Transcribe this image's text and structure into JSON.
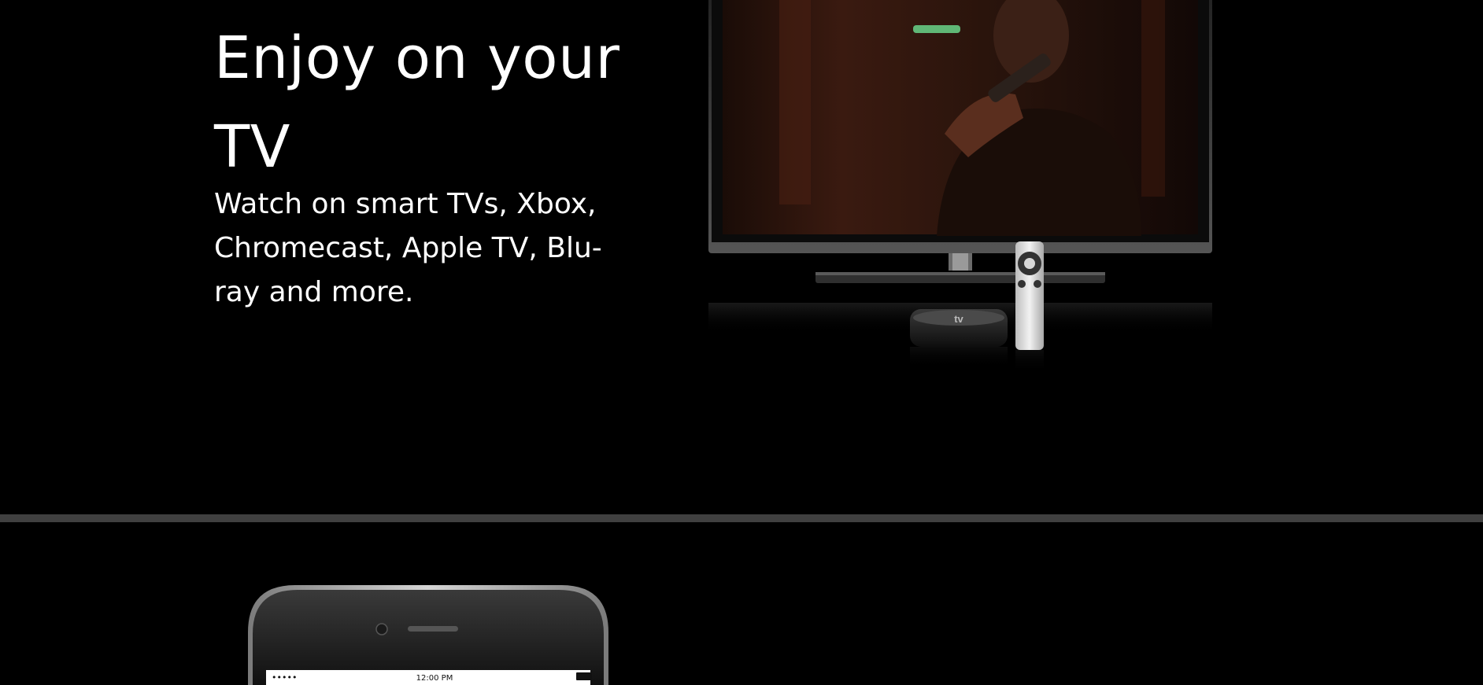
{
  "tv_section": {
    "title": "Enjoy on your TV",
    "subtitle": "Watch on smart TVs, Xbox, Chromecast, Apple TV, Blu-ray and more.",
    "apple_tv_label": "tv"
  },
  "phone_section": {
    "status_time": "12:00 PM",
    "signal": "•••••"
  },
  "colors": {
    "background": "#000000",
    "divider": "#404040",
    "text": "#ffffff"
  }
}
